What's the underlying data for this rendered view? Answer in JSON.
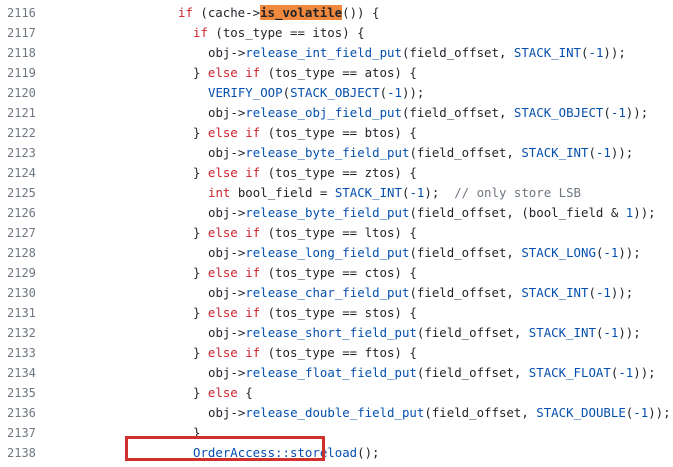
{
  "code": {
    "lines": [
      {
        "number": "2116",
        "indent": 14,
        "tokens": [
          {
            "t": "if",
            "k": "kw"
          },
          {
            "t": " (cache->",
            "k": "plain"
          },
          {
            "t": "is_volatile",
            "k": "hl"
          },
          {
            "t": "()) {",
            "k": "plain"
          }
        ]
      },
      {
        "number": "2117",
        "indent": 16,
        "tokens": [
          {
            "t": "if",
            "k": "kw"
          },
          {
            "t": " (tos_type == itos) {",
            "k": "plain"
          }
        ]
      },
      {
        "number": "2118",
        "indent": 18,
        "tokens": [
          {
            "t": "obj->",
            "k": "plain"
          },
          {
            "t": "release_int_field_put",
            "k": "fn"
          },
          {
            "t": "(field_offset, ",
            "k": "plain"
          },
          {
            "t": "STACK_INT",
            "k": "mac"
          },
          {
            "t": "(",
            "k": "plain"
          },
          {
            "t": "-1",
            "k": "num"
          },
          {
            "t": "));",
            "k": "plain"
          }
        ]
      },
      {
        "number": "2119",
        "indent": 16,
        "tokens": [
          {
            "t": "} ",
            "k": "plain"
          },
          {
            "t": "else if",
            "k": "kw"
          },
          {
            "t": " (tos_type == atos) {",
            "k": "plain"
          }
        ]
      },
      {
        "number": "2120",
        "indent": 18,
        "tokens": [
          {
            "t": "VERIFY_OOP",
            "k": "mac"
          },
          {
            "t": "(",
            "k": "plain"
          },
          {
            "t": "STACK_OBJECT",
            "k": "mac"
          },
          {
            "t": "(",
            "k": "plain"
          },
          {
            "t": "-1",
            "k": "num"
          },
          {
            "t": "));",
            "k": "plain"
          }
        ]
      },
      {
        "number": "2121",
        "indent": 18,
        "tokens": [
          {
            "t": "obj->",
            "k": "plain"
          },
          {
            "t": "release_obj_field_put",
            "k": "fn"
          },
          {
            "t": "(field_offset, ",
            "k": "plain"
          },
          {
            "t": "STACK_OBJECT",
            "k": "mac"
          },
          {
            "t": "(",
            "k": "plain"
          },
          {
            "t": "-1",
            "k": "num"
          },
          {
            "t": "));",
            "k": "plain"
          }
        ]
      },
      {
        "number": "2122",
        "indent": 16,
        "tokens": [
          {
            "t": "} ",
            "k": "plain"
          },
          {
            "t": "else if",
            "k": "kw"
          },
          {
            "t": " (tos_type == btos) {",
            "k": "plain"
          }
        ]
      },
      {
        "number": "2123",
        "indent": 18,
        "tokens": [
          {
            "t": "obj->",
            "k": "plain"
          },
          {
            "t": "release_byte_field_put",
            "k": "fn"
          },
          {
            "t": "(field_offset, ",
            "k": "plain"
          },
          {
            "t": "STACK_INT",
            "k": "mac"
          },
          {
            "t": "(",
            "k": "plain"
          },
          {
            "t": "-1",
            "k": "num"
          },
          {
            "t": "));",
            "k": "plain"
          }
        ]
      },
      {
        "number": "2124",
        "indent": 16,
        "tokens": [
          {
            "t": "} ",
            "k": "plain"
          },
          {
            "t": "else if",
            "k": "kw"
          },
          {
            "t": " (tos_type == ztos) {",
            "k": "plain"
          }
        ]
      },
      {
        "number": "2125",
        "indent": 18,
        "tokens": [
          {
            "t": "int",
            "k": "kw"
          },
          {
            "t": " bool_field = ",
            "k": "plain"
          },
          {
            "t": "STACK_INT",
            "k": "mac"
          },
          {
            "t": "(",
            "k": "plain"
          },
          {
            "t": "-1",
            "k": "num"
          },
          {
            "t": ");  ",
            "k": "plain"
          },
          {
            "t": "// only store LSB",
            "k": "com"
          }
        ]
      },
      {
        "number": "2126",
        "indent": 18,
        "tokens": [
          {
            "t": "obj->",
            "k": "plain"
          },
          {
            "t": "release_byte_field_put",
            "k": "fn"
          },
          {
            "t": "(field_offset, (bool_field & ",
            "k": "plain"
          },
          {
            "t": "1",
            "k": "num"
          },
          {
            "t": "));",
            "k": "plain"
          }
        ]
      },
      {
        "number": "2127",
        "indent": 16,
        "tokens": [
          {
            "t": "} ",
            "k": "plain"
          },
          {
            "t": "else if",
            "k": "kw"
          },
          {
            "t": " (tos_type == ltos) {",
            "k": "plain"
          }
        ]
      },
      {
        "number": "2128",
        "indent": 18,
        "tokens": [
          {
            "t": "obj->",
            "k": "plain"
          },
          {
            "t": "release_long_field_put",
            "k": "fn"
          },
          {
            "t": "(field_offset, ",
            "k": "plain"
          },
          {
            "t": "STACK_LONG",
            "k": "mac"
          },
          {
            "t": "(",
            "k": "plain"
          },
          {
            "t": "-1",
            "k": "num"
          },
          {
            "t": "));",
            "k": "plain"
          }
        ]
      },
      {
        "number": "2129",
        "indent": 16,
        "tokens": [
          {
            "t": "} ",
            "k": "plain"
          },
          {
            "t": "else if",
            "k": "kw"
          },
          {
            "t": " (tos_type == ctos) {",
            "k": "plain"
          }
        ]
      },
      {
        "number": "2130",
        "indent": 18,
        "tokens": [
          {
            "t": "obj->",
            "k": "plain"
          },
          {
            "t": "release_char_field_put",
            "k": "fn"
          },
          {
            "t": "(field_offset, ",
            "k": "plain"
          },
          {
            "t": "STACK_INT",
            "k": "mac"
          },
          {
            "t": "(",
            "k": "plain"
          },
          {
            "t": "-1",
            "k": "num"
          },
          {
            "t": "));",
            "k": "plain"
          }
        ]
      },
      {
        "number": "2131",
        "indent": 16,
        "tokens": [
          {
            "t": "} ",
            "k": "plain"
          },
          {
            "t": "else if",
            "k": "kw"
          },
          {
            "t": " (tos_type == stos) {",
            "k": "plain"
          }
        ]
      },
      {
        "number": "2132",
        "indent": 18,
        "tokens": [
          {
            "t": "obj->",
            "k": "plain"
          },
          {
            "t": "release_short_field_put",
            "k": "fn"
          },
          {
            "t": "(field_offset, ",
            "k": "plain"
          },
          {
            "t": "STACK_INT",
            "k": "mac"
          },
          {
            "t": "(",
            "k": "plain"
          },
          {
            "t": "-1",
            "k": "num"
          },
          {
            "t": "));",
            "k": "plain"
          }
        ]
      },
      {
        "number": "2133",
        "indent": 16,
        "tokens": [
          {
            "t": "} ",
            "k": "plain"
          },
          {
            "t": "else if",
            "k": "kw"
          },
          {
            "t": " (tos_type == ftos) {",
            "k": "plain"
          }
        ]
      },
      {
        "number": "2134",
        "indent": 18,
        "tokens": [
          {
            "t": "obj->",
            "k": "plain"
          },
          {
            "t": "release_float_field_put",
            "k": "fn"
          },
          {
            "t": "(field_offset, ",
            "k": "plain"
          },
          {
            "t": "STACK_FLOAT",
            "k": "mac"
          },
          {
            "t": "(",
            "k": "plain"
          },
          {
            "t": "-1",
            "k": "num"
          },
          {
            "t": "));",
            "k": "plain"
          }
        ]
      },
      {
        "number": "2135",
        "indent": 16,
        "tokens": [
          {
            "t": "} ",
            "k": "plain"
          },
          {
            "t": "else",
            "k": "kw"
          },
          {
            "t": " {",
            "k": "plain"
          }
        ]
      },
      {
        "number": "2136",
        "indent": 18,
        "tokens": [
          {
            "t": "obj->",
            "k": "plain"
          },
          {
            "t": "release_double_field_put",
            "k": "fn"
          },
          {
            "t": "(field_offset, ",
            "k": "plain"
          },
          {
            "t": "STACK_DOUBLE",
            "k": "mac"
          },
          {
            "t": "(",
            "k": "plain"
          },
          {
            "t": "-1",
            "k": "num"
          },
          {
            "t": "));",
            "k": "plain"
          }
        ]
      },
      {
        "number": "2137",
        "indent": 16,
        "tokens": [
          {
            "t": "}",
            "k": "plain"
          }
        ]
      },
      {
        "number": "2138",
        "indent": 16,
        "tokens": [
          {
            "t": "OrderAccess::storeload",
            "k": "fn"
          },
          {
            "t": "();",
            "k": "plain"
          }
        ]
      }
    ]
  },
  "colors": {
    "keyword": "#cf222e",
    "function": "#0550ae",
    "line_number": "#6e7781",
    "search_highlight": "#f0883e",
    "annotation_box": "#d0312d"
  }
}
